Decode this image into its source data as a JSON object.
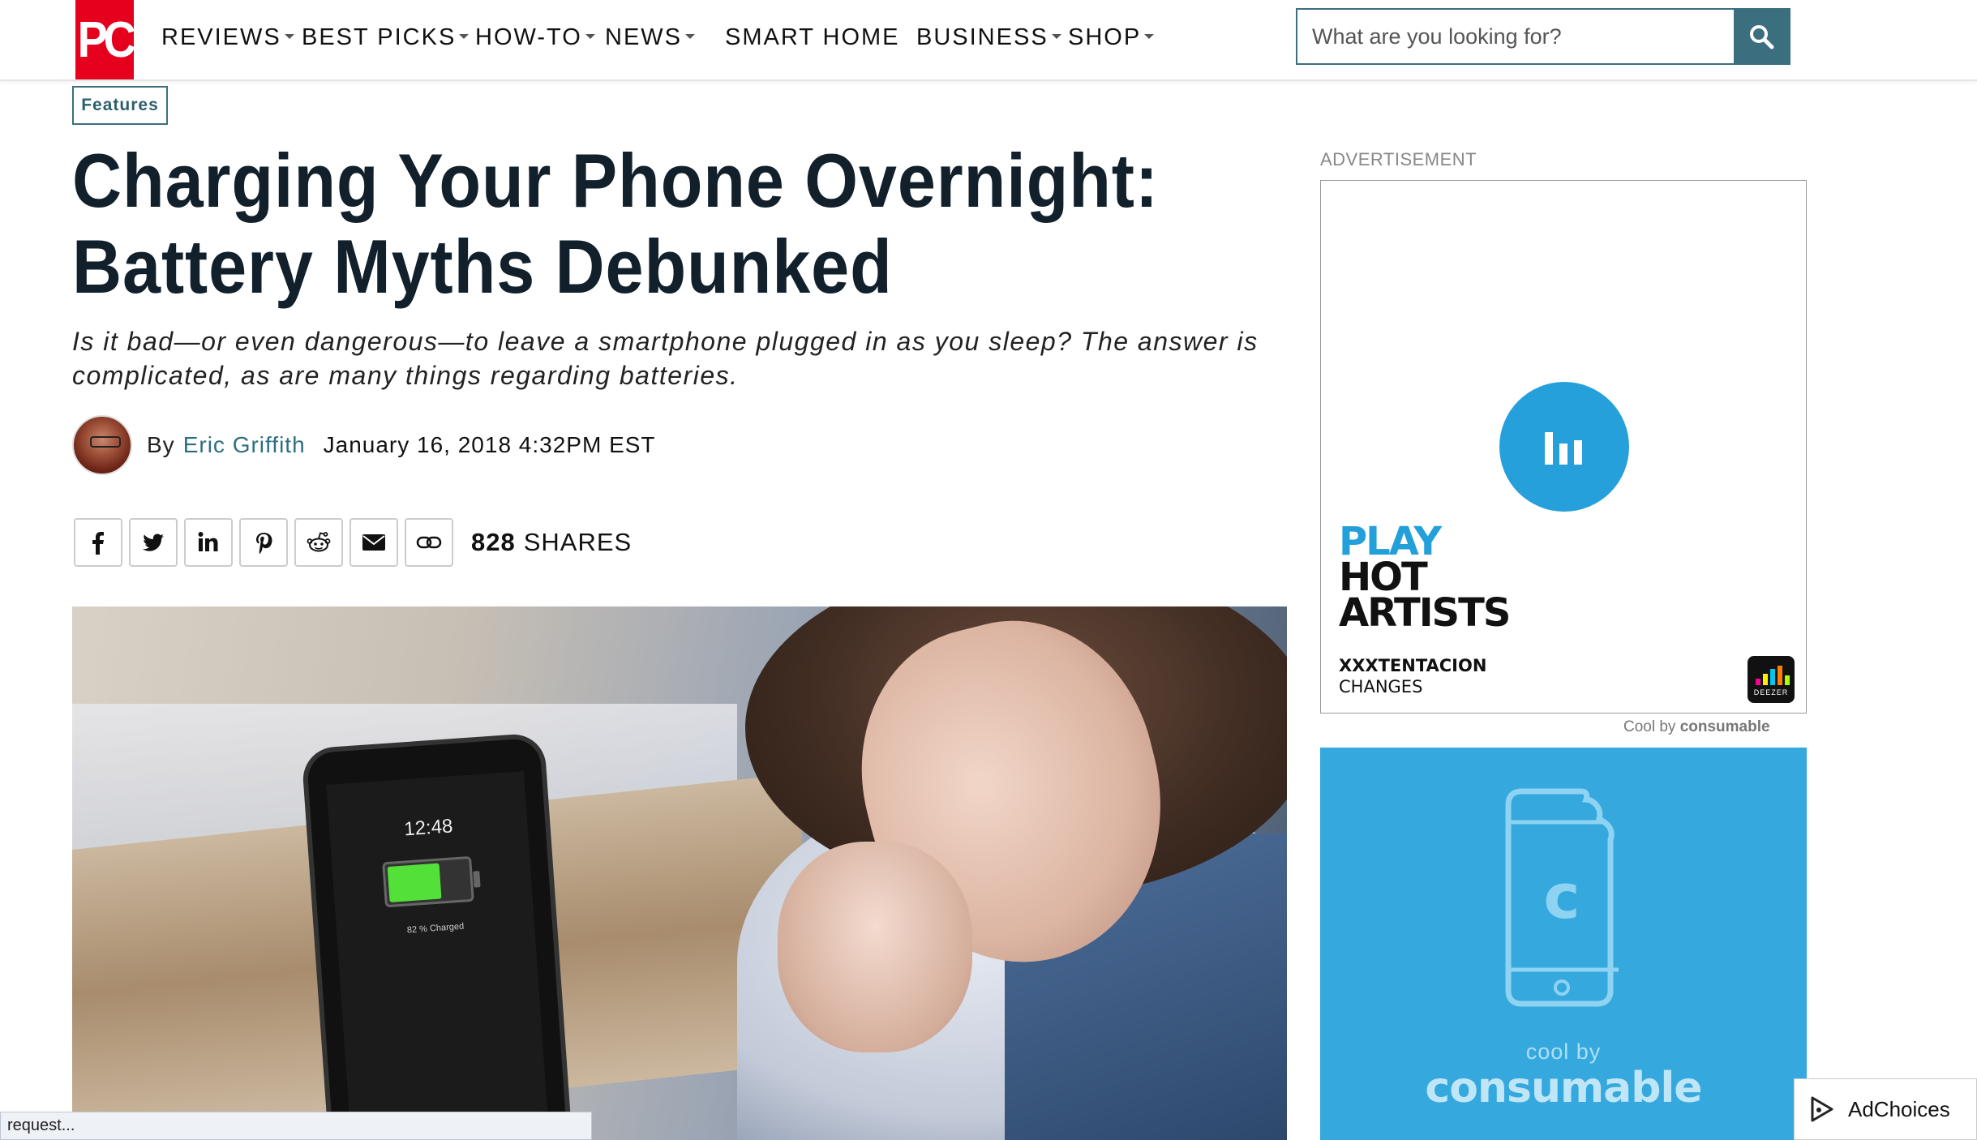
{
  "header": {
    "logo_text": "PC",
    "nav": [
      {
        "label": "REVIEWS",
        "dropdown": true
      },
      {
        "label": "BEST PICKS",
        "dropdown": true
      },
      {
        "label": "HOW-TO",
        "dropdown": true
      },
      {
        "label": "NEWS",
        "dropdown": true
      },
      {
        "label": "SMART HOME",
        "dropdown": false
      },
      {
        "label": "BUSINESS",
        "dropdown": true
      },
      {
        "label": "SHOP",
        "dropdown": true
      }
    ],
    "search": {
      "placeholder": "What are you looking for?",
      "icon": "search-icon"
    }
  },
  "article": {
    "category": "Features",
    "title_line1": "Charging Your Phone Overnight:",
    "title_line2": "Battery Myths Debunked",
    "subtitle": "Is it bad—or even dangerous—to leave a smartphone plugged in as you sleep? The answer is complicated, as are many things regarding batteries.",
    "by": "By",
    "author": "Eric Griffith",
    "date": "January 16, 2018 4:32PM EST",
    "share_buttons": [
      "facebook-icon",
      "twitter-icon",
      "linkedin-icon",
      "pinterest-icon",
      "reddit-icon",
      "email-icon",
      "link-icon"
    ],
    "share_count": "828",
    "share_label": "SHARES",
    "hero": {
      "phone_time": "12:48",
      "phone_status": "82 % Charged",
      "battery_level": 0.62
    }
  },
  "sidebar": {
    "ad_label": "ADVERTISEMENT",
    "ad1": {
      "line1": "PLAY",
      "line2": "HOT",
      "line3": "ARTISTS",
      "artist": "XXXTENTACION",
      "song": "CHANGES",
      "app_name": "DEEZER",
      "accent": "#23a0d9"
    },
    "cool_by_prefix": "Cool by",
    "cool_by_brand": "consumable",
    "ad2": {
      "cool_by": "cool by",
      "brand": "consumable",
      "background": "#35a8de"
    },
    "adchoices": "AdChoices"
  },
  "status_bar": "request..."
}
